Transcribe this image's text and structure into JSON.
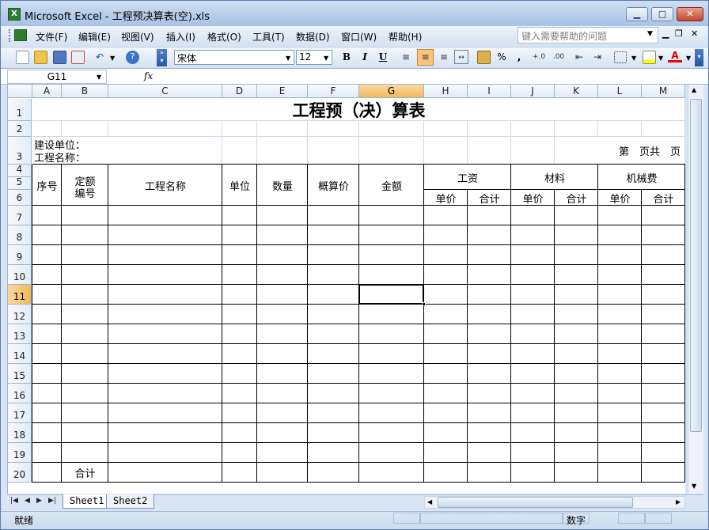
{
  "window": {
    "title": "Microsoft Excel - 工程预决算表(空).xls",
    "icon": "excel-icon"
  },
  "menu": [
    "文件(F)",
    "编辑(E)",
    "视图(V)",
    "插入(I)",
    "格式(O)",
    "工具(T)",
    "数据(D)",
    "窗口(W)",
    "帮助(H)"
  ],
  "help_placeholder": "键入需要帮助的问题",
  "toolbar": {
    "font": "宋体",
    "size": "12",
    "bold": "B",
    "italic": "I",
    "underline": "U",
    "percent": "%",
    "comma": ","
  },
  "formula": {
    "namebox": "G11",
    "fx": "fx",
    "value": ""
  },
  "columns": [
    "A",
    "B",
    "C",
    "D",
    "E",
    "F",
    "G",
    "H",
    "I",
    "J",
    "K",
    "L",
    "M"
  ],
  "selected_col": "G",
  "rows": [
    "1",
    "2",
    "3",
    "4",
    "5",
    "6",
    "7",
    "8",
    "9",
    "10",
    "11",
    "12",
    "13",
    "14",
    "15",
    "16",
    "17",
    "18",
    "19",
    "20"
  ],
  "selected_row": "11",
  "sheet": {
    "title": "工程预（决）算表",
    "unit_label": "建设单位：",
    "name_label": "工程名称：",
    "page_label": "第　页共　页",
    "h_seq": "序号",
    "h_quota_1": "定额",
    "h_quota_2": "编号",
    "h_name": "工程名称",
    "h_unit": "单位",
    "h_qty": "数量",
    "h_est": "概算价",
    "h_amount": "金额",
    "h_wage": "工资",
    "h_material": "材料",
    "h_machine": "机械费",
    "h_price": "单价",
    "h_total": "合计",
    "total": "合计"
  },
  "tabs": [
    "Sheet1",
    "Sheet2"
  ],
  "status": {
    "ready": "就绪",
    "num": "数字"
  }
}
